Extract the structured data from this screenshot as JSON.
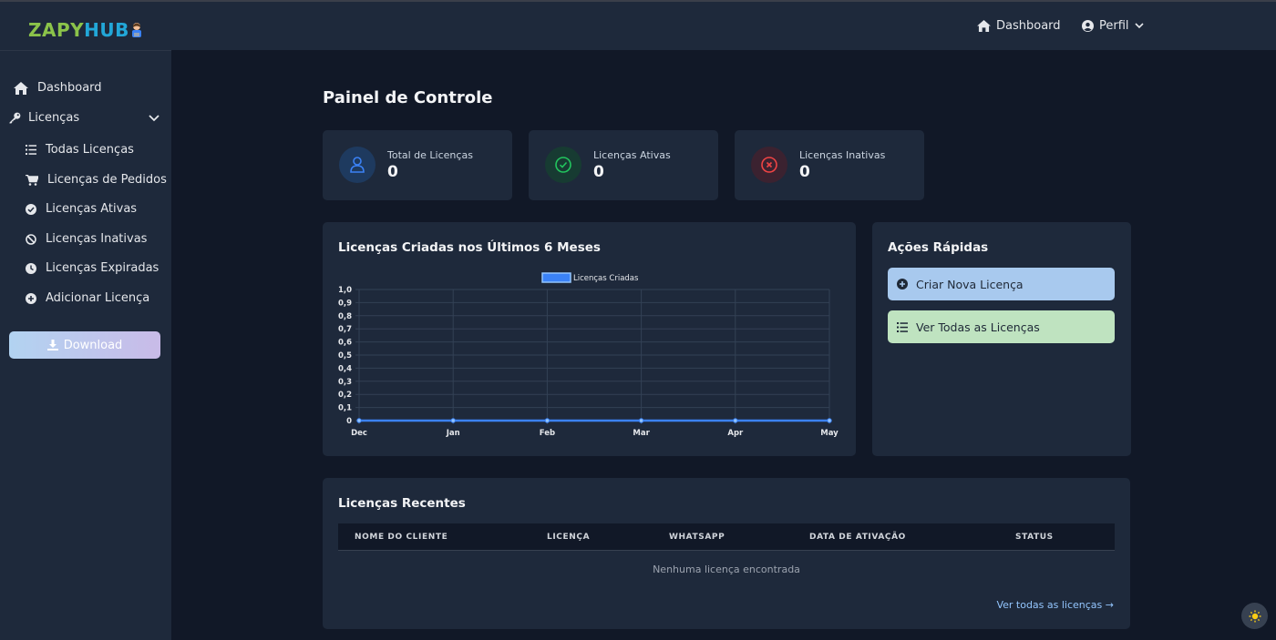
{
  "brand": {
    "part1": "ZAPY",
    "part2": "HUB"
  },
  "topnav": {
    "dashboard": "Dashboard",
    "profile": "Perfil"
  },
  "sidebar": {
    "items": [
      {
        "label": "Dashboard",
        "icon": "home-icon"
      },
      {
        "label": "Licenças",
        "icon": "key-icon"
      },
      {
        "label": "Todas Licenças",
        "icon": "list-icon"
      },
      {
        "label": "Licenças de Pedidos",
        "icon": "cart-icon"
      },
      {
        "label": "Licenças Ativas",
        "icon": "check-circle-icon"
      },
      {
        "label": "Licenças Inativas",
        "icon": "ban-icon"
      },
      {
        "label": "Licenças Expiradas",
        "icon": "clock-icon"
      },
      {
        "label": "Adicionar Licença",
        "icon": "plus-circle-icon"
      }
    ],
    "download": "Download"
  },
  "main": {
    "title": "Painel de Controle",
    "stats": [
      {
        "label": "Total de Licenças",
        "value": "0",
        "color": "#3b82f6"
      },
      {
        "label": "Licenças Ativas",
        "value": "0",
        "color": "#22c55e"
      },
      {
        "label": "Licenças Inativas",
        "value": "0",
        "color": "#ef4444"
      }
    ],
    "chart_panel": {
      "title": "Licenças Criadas nos Últimos 6 Meses"
    },
    "quick_actions": {
      "title": "Ações Rápidas",
      "create": "Criar Nova Licença",
      "view_all": "Ver Todas as Licenças"
    },
    "recent": {
      "title": "Licenças Recentes",
      "columns": [
        "NOME DO CLIENTE",
        "LICENÇA",
        "WHATSAPP",
        "DATA DE ATIVAÇÃO",
        "STATUS"
      ],
      "empty": "Nenhuma licença encontrada",
      "view_all": "Ver todas as licenças →"
    }
  },
  "chart_data": {
    "type": "line",
    "categories": [
      "Dec",
      "Jan",
      "Feb",
      "Mar",
      "Apr",
      "May"
    ],
    "series": [
      {
        "name": "Licenças Criadas",
        "values": [
          0,
          0,
          0,
          0,
          0,
          0
        ],
        "color": "#3b82f6"
      }
    ],
    "yticks": [
      "1,0",
      "0,9",
      "0,8",
      "0,7",
      "0,6",
      "0,5",
      "0,4",
      "0,3",
      "0,2",
      "0,1",
      "0"
    ],
    "ylim": [
      0,
      1
    ],
    "grid": true,
    "legend": "top-center"
  }
}
